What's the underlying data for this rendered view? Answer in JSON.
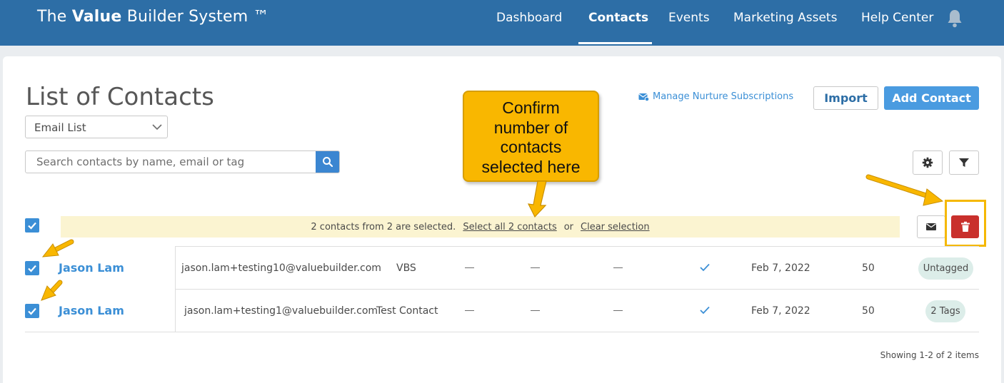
{
  "colors": {
    "nav_bg": "#2d6ea6",
    "accent": "#3b8fd6",
    "add_button": "#4a9be0",
    "danger": "#c9302c",
    "banner_bg": "#fbf4d1",
    "tag_bg": "#dcede9",
    "callout": "#f9b700"
  },
  "header": {
    "brand_prefix": "The",
    "brand_bold": "Value",
    "brand_suffix": "Builder System ™",
    "nav": [
      "Dashboard",
      "Contacts",
      "Events",
      "Marketing Assets",
      "Help Center"
    ],
    "active_nav": "Contacts",
    "bell_icon": "bell-icon"
  },
  "page": {
    "title": "List of Contacts",
    "list_select": {
      "value": "Email List",
      "icon": "chevron-down-icon"
    },
    "search": {
      "placeholder": "Search contacts by name, email or tag",
      "icon": "search-icon"
    },
    "nurture_link": {
      "label": "Manage Nurture Subscriptions",
      "icon": "envelope-settings-icon"
    },
    "import_label": "Import",
    "add_label": "Add Contact",
    "settings_icon": "gear-icon",
    "filter_icon": "filter-icon"
  },
  "selection": {
    "text": "2 contacts from 2 are selected.",
    "select_all": "Select all 2 contacts",
    "or": "or",
    "clear": "Clear selection",
    "mail_icon": "envelope-icon",
    "delete_icon": "trash-icon"
  },
  "contacts": [
    {
      "selected": true,
      "name": "Jason Lam",
      "email": "jason.lam+testing10@valuebuilder.com",
      "company": "VBS",
      "c1": "—",
      "c2": "—",
      "c3": "—",
      "subscribed": true,
      "date": "Feb 7, 2022",
      "score": "50",
      "tag": "Untagged"
    },
    {
      "selected": true,
      "name": "Jason Lam",
      "email": "jason.lam+testing1@valuebuilder.com",
      "company": "Test Contact",
      "c1": "—",
      "c2": "—",
      "c3": "—",
      "subscribed": true,
      "date": "Feb 7, 2022",
      "score": "50",
      "tag": "2 Tags"
    }
  ],
  "footer": {
    "count": "Showing 1-2 of 2 items"
  },
  "annotation": {
    "callout_lines": [
      "Confirm",
      "number of",
      "contacts",
      "selected here"
    ]
  }
}
